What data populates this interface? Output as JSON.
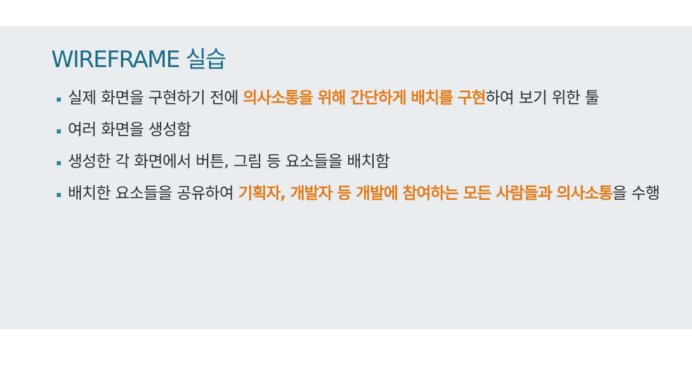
{
  "slide": {
    "title": "WIREFRAME 실습",
    "colors": {
      "panel_background": "#e9edf0",
      "title": "#1c6b86",
      "bullet": "#2b87a6",
      "text": "#2e2e2e",
      "highlight": "#e07b19"
    },
    "bullets": [
      {
        "before": "실제 화면을 구현하기 전에 ",
        "highlight": "의사소통을 위해 간단하게 배치를 구현",
        "after": "하여 보기 위한 툴"
      },
      {
        "text": "여러 화면을 생성함"
      },
      {
        "text": "생성한 각 화면에서 버튼, 그림 등 요소들을 배치함"
      },
      {
        "before": "배치한 요소들을 공유하여 ",
        "highlight1": "기획자, 개발자 등 개발에 참여하는 모든 사람들과 의사소통",
        "after": "을 수행"
      }
    ]
  }
}
